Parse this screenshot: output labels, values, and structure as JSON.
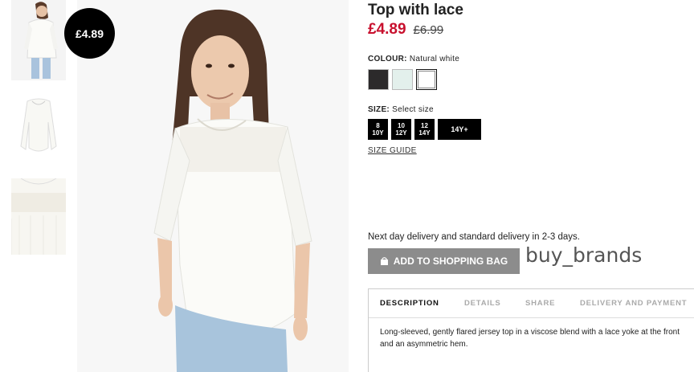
{
  "badge": {
    "price": "£4.89"
  },
  "product": {
    "title": "Top with lace",
    "price_now": "£4.89",
    "price_was": "£6.99"
  },
  "colour": {
    "label": "COLOUR:",
    "selected": "Natural white",
    "swatches": [
      "black",
      "mint",
      "white"
    ]
  },
  "size": {
    "label": "SIZE:",
    "prompt": "Select size",
    "options": [
      "8\n10Y",
      "10\n12Y",
      "12\n14Y",
      "14Y+"
    ]
  },
  "size_guide": "SIZE GUIDE",
  "delivery_note": "Next day delivery and standard delivery in 2-3 days.",
  "add_to_bag": "ADD TO SHOPPING BAG",
  "watermark": "buy_brands",
  "tabs": [
    "DESCRIPTION",
    "DETAILS",
    "SHARE",
    "DELIVERY AND PAYMENT"
  ],
  "description": "Long-sleeved, gently flared jersey top in a viscose blend with a lace yoke at the front and an asymmetric hem.",
  "colors": {
    "sale": "#c8102e",
    "button": "#8c8c8c"
  }
}
